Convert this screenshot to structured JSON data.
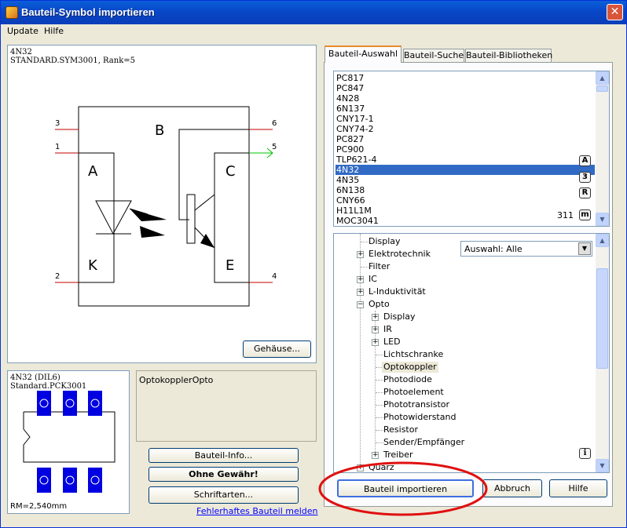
{
  "window": {
    "title": "Bauteil-Symbol importieren",
    "close_glyph": "✕"
  },
  "menu": {
    "update": "Update",
    "help": "Hilfe"
  },
  "symbol_preview": {
    "name": "4N32",
    "source": "STANDARD.SYM3001, Rank=5",
    "pins": {
      "p3": "3",
      "p1": "1",
      "p2": "2",
      "p6": "6",
      "p5": "5",
      "p4": "4"
    },
    "labels": {
      "b": "B",
      "a": "A",
      "k": "K",
      "c": "C",
      "e": "E"
    },
    "pin5_color": "#00c000",
    "pin_color": "#c00000"
  },
  "buttons": {
    "gehaeuse": "Gehäuse...",
    "bauteil_info": "Bauteil-Info...",
    "ohne_gewaehr": "Ohne Gewähr!",
    "schriftarten": "Schriftarten...",
    "import": "Bauteil importieren",
    "abbruch": "Abbruch",
    "hilfe": "Hilfe"
  },
  "package_preview": {
    "name": "4N32 (DIL6)",
    "source": "Standard.PCK3001",
    "rm": "RM=2,540mm",
    "pad_color": "#0000e0"
  },
  "description": "OptokopplerOpto",
  "report_link": "Fehlerhaftes Bauteil melden",
  "tabs": [
    {
      "label": "Bauteil-Auswahl",
      "active": true
    },
    {
      "label": "Bauteil-Suche",
      "active": false
    },
    {
      "label": "Bauteil-Bibliotheken",
      "active": false
    }
  ],
  "component_list": {
    "items": [
      "PC817",
      "PC847",
      "4N28",
      "6N137",
      "CNY17-1",
      "CNY74-2",
      "PC827",
      "PC900",
      "TLP621-4",
      "4N32",
      "4N35",
      "6N138",
      "CNY66",
      "H11L1M",
      "MOC3041"
    ],
    "selected": "4N32",
    "count": "311",
    "badges": [
      "A",
      "3",
      "R",
      "m"
    ]
  },
  "filter": {
    "value": "Auswahl: Alle"
  },
  "tree": {
    "display": "Display",
    "elektrotechnik": "Elektrotechnik",
    "filter": "Filter",
    "ic": "IC",
    "l_induktivitaet": "L-Induktivität",
    "opto": "Opto",
    "opto_display": "Display",
    "ir": "IR",
    "led": "LED",
    "lichtschranke": "Lichtschranke",
    "optokoppler": "Optokoppler",
    "photodiode": "Photodiode",
    "photoelement": "Photoelement",
    "phototransistor": "Phototransistor",
    "photowiderstand": "Photowiderstand",
    "resistor": "Resistor",
    "sender": "Sender/Empfänger",
    "treiber": "Treiber",
    "quarz": "Quarz",
    "info_badge": "i"
  }
}
